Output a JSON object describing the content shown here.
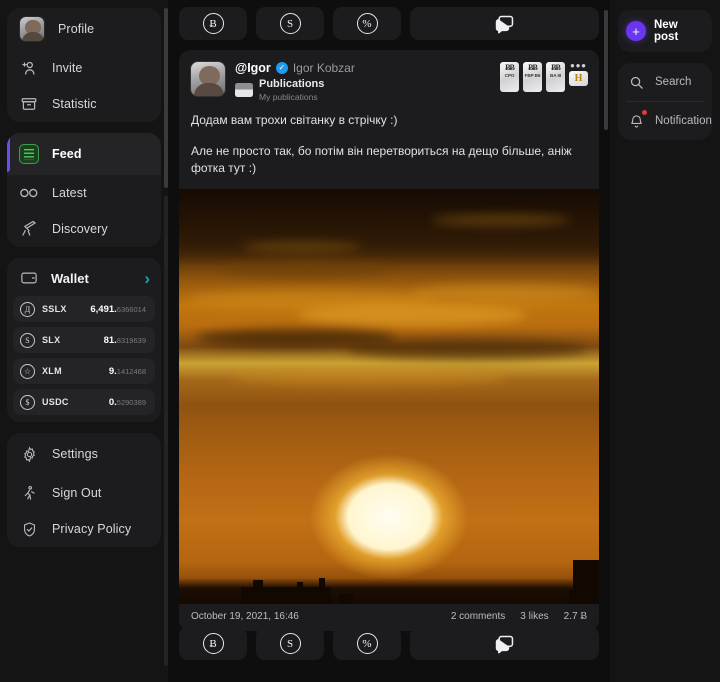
{
  "sidebar_left": {
    "nav_primary": [
      {
        "label": "Profile",
        "icon": "avatar-icon",
        "active": false
      },
      {
        "label": "Invite",
        "icon": "add-person-icon",
        "active": false
      },
      {
        "label": "Statistic",
        "icon": "archive-icon",
        "active": false
      }
    ],
    "nav_secondary": [
      {
        "label": "Feed",
        "icon": "feed-icon",
        "active": true
      },
      {
        "label": "Latest",
        "icon": "infinity-icon",
        "active": false
      },
      {
        "label": "Discovery",
        "icon": "telescope-icon",
        "active": false
      }
    ],
    "wallet": {
      "title": "Wallet",
      "chevron": "›",
      "tokens": [
        {
          "name": "SSLX",
          "symbol": "Д",
          "int": "6,491.",
          "dec": "6366014"
        },
        {
          "name": "SLX",
          "symbol": "S",
          "int": "81.",
          "dec": "8319639"
        },
        {
          "name": "XLM",
          "symbol": "☆",
          "int": "9.",
          "dec": "1412468"
        },
        {
          "name": "USDC",
          "symbol": "$",
          "int": "0.",
          "dec": "5290389"
        }
      ]
    },
    "nav_footer": [
      {
        "label": "Settings",
        "icon": "gear-icon"
      },
      {
        "label": "Sign Out",
        "icon": "walking-person-icon"
      },
      {
        "label": "Privacy Policy",
        "icon": "shield-check-icon"
      }
    ]
  },
  "action_bar": {
    "buttons": [
      {
        "name": "bitcoin-tip-button",
        "glyph": "Ƀ"
      },
      {
        "name": "dollar-tip-button",
        "glyph": "S"
      },
      {
        "name": "percent-tip-button",
        "glyph": "%"
      },
      {
        "name": "comment-button",
        "glyph": "comment-icon"
      }
    ]
  },
  "post": {
    "handle": "@Igor",
    "verified_glyph": "✓",
    "fullname": "Igor Kobzar",
    "publication_title": "Publications",
    "publication_subtitle": "My publications",
    "badges": [
      {
        "glyph": "ɃɃ",
        "caption": "CPO"
      },
      {
        "glyph": "ɃɃ",
        "caption": "FBP B6"
      },
      {
        "glyph": "ɃɃ",
        "caption": "BA III"
      }
    ],
    "more_glyph": "•••",
    "highlight_badge": "H",
    "text": [
      "Додам вам трохи світанку в стрічку :)",
      "Але не просто так, бо потім він перетвориться на дещо більше, аніж фотка тут :)"
    ],
    "image_alt": "sunset-photo",
    "date": "October 19, 2021, 16:46",
    "comments": "2 comments",
    "likes": "3 likes",
    "tip_amount": "2.7",
    "tip_currency": "Ƀ"
  },
  "sidebar_right": {
    "new_post": "New post",
    "items": [
      {
        "label": "Search",
        "icon": "search-icon"
      },
      {
        "label": "Notifications",
        "icon": "bell-icon"
      }
    ]
  },
  "colors": {
    "accent_purple": "#6a36f0",
    "accent_teal": "#0ea5b5",
    "verified_blue": "#1d9bf0",
    "feed_green": "#49d15c",
    "panel": "#1c1c1e",
    "bg": "#141414"
  }
}
